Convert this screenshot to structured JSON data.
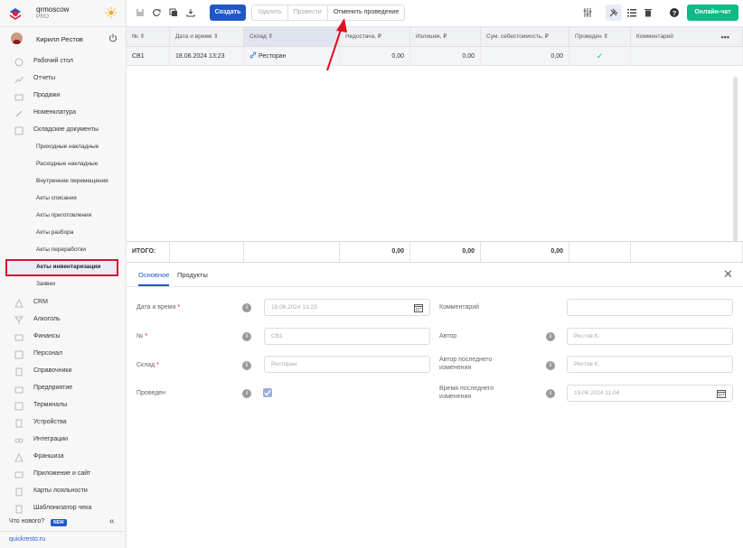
{
  "app": {
    "name": "qrmoscow",
    "plan": "PRO",
    "user": "Кирилл Рестов",
    "whats_new": "Что нового?",
    "new_badge": "NEW",
    "site": "quickresto.ru"
  },
  "nav": [
    {
      "label": "Рабочий стол",
      "icon": "dashboard-icon"
    },
    {
      "label": "Отчеты",
      "icon": "reports-icon"
    },
    {
      "label": "Продажи",
      "icon": "sales-icon"
    },
    {
      "label": "Номенклатура",
      "icon": "nomenclature-icon"
    },
    {
      "label": "Складские документы",
      "icon": "warehouse-icon"
    }
  ],
  "subnav": [
    "Приходные накладные",
    "Расходные накладные",
    "Внутренние перемещения",
    "Акты списания",
    "Акты приготовления",
    "Акты разбора",
    "Акты переработки",
    "Акты инвентаризации",
    "Заявки"
  ],
  "nav2": [
    {
      "label": "CRM",
      "icon": "crm-icon"
    },
    {
      "label": "Алкоголь",
      "icon": "alcohol-icon"
    },
    {
      "label": "Финансы",
      "icon": "finance-icon"
    },
    {
      "label": "Персонал",
      "icon": "staff-icon"
    },
    {
      "label": "Справочники",
      "icon": "directory-icon"
    },
    {
      "label": "Предприятие",
      "icon": "enterprise-icon"
    },
    {
      "label": "Терминалы",
      "icon": "terminal-icon"
    },
    {
      "label": "Устройства",
      "icon": "device-icon"
    },
    {
      "label": "Интеграции",
      "icon": "integration-icon"
    },
    {
      "label": "Франшиза",
      "icon": "franchise-icon"
    },
    {
      "label": "Приложение и сайт",
      "icon": "app-site-icon"
    },
    {
      "label": "Карты лояльности",
      "icon": "loyalty-icon"
    },
    {
      "label": "Шаблонизатор чека",
      "icon": "receipt-template-icon"
    }
  ],
  "toolbar": {
    "create": "Создать",
    "delete": "Удалить",
    "post": "Провести",
    "unpost": "Отменить проведение",
    "chat": "Онлайн-чат"
  },
  "grid": {
    "headers": [
      "№",
      "Дата и время",
      "Склад",
      "Недостача, ₽",
      "Излишек, ₽",
      "Сум. себестоимость, ₽",
      "Проведен",
      "Комментарий"
    ],
    "row": {
      "num": "СВ1",
      "datetime": "18.06.2024 13:23",
      "warehouse": "Ресторан",
      "shortage": "0,00",
      "surplus": "0,00",
      "cost": "0,00",
      "comment": ""
    },
    "footer": {
      "label": "ИТОГО:",
      "shortage": "0,00",
      "surplus": "0,00",
      "cost": "0,00"
    }
  },
  "detail": {
    "tabs": [
      "Основное",
      "Продукты"
    ],
    "fields": {
      "datetime": {
        "label": "Дата и время",
        "value": "18.06.2024 13:23"
      },
      "num": {
        "label": "№",
        "value": "СВ1"
      },
      "warehouse": {
        "label": "Склад",
        "value": "Ресторан"
      },
      "posted": {
        "label": "Проведен"
      },
      "comment": {
        "label": "Комментарий",
        "value": ""
      },
      "author": {
        "label": "Автор",
        "value": "Рестов К."
      },
      "last_author": {
        "label1": "Автор последнего",
        "label2": "изменения",
        "value": "Рестов К."
      },
      "last_time": {
        "label1": "Время последнего",
        "label2": "изменения",
        "value": "19.06.2024 11:04"
      }
    }
  }
}
